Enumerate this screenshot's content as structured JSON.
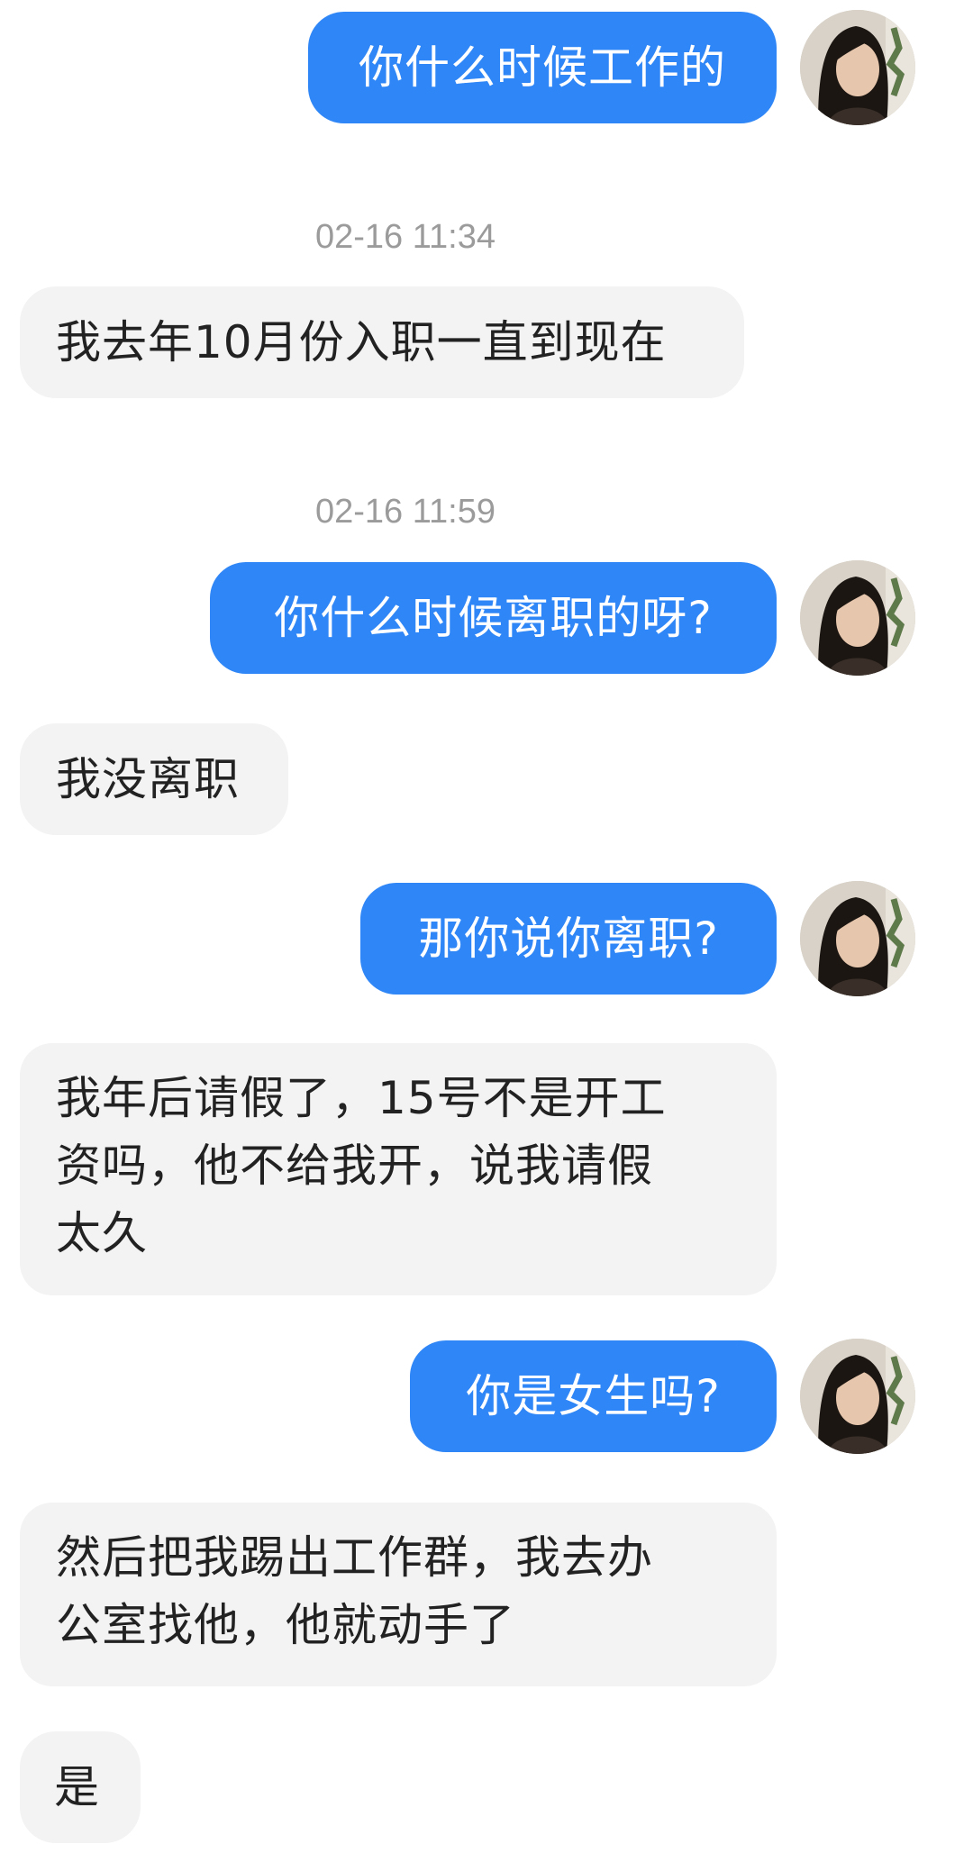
{
  "conversation": {
    "messages": [
      {
        "type": "outgoing",
        "text": "你什么时候工作的"
      },
      {
        "type": "timestamp",
        "text": "02-16 11:34"
      },
      {
        "type": "incoming",
        "text": "我去年10月份入职一直到现在"
      },
      {
        "type": "timestamp",
        "text": "02-16 11:59"
      },
      {
        "type": "outgoing",
        "text": "你什么时候离职的呀?"
      },
      {
        "type": "incoming",
        "text": "我没离职"
      },
      {
        "type": "outgoing",
        "text": "那你说你离职?"
      },
      {
        "type": "incoming",
        "text": "我年后请假了，15号不是开工\n资吗，他不给我开，说我请假\n太久"
      },
      {
        "type": "outgoing",
        "text": "你是女生吗?"
      },
      {
        "type": "incoming",
        "text": "然后把我踢出工作群，我去办\n公室找他，他就动手了"
      },
      {
        "type": "incoming",
        "text": "是"
      }
    ]
  },
  "avatar_icon": "user-avatar-icon",
  "colors": {
    "outgoing_bubble": "#2f86f6",
    "incoming_bubble": "#f3f3f3",
    "timestamp_text": "#9b9b9b"
  }
}
